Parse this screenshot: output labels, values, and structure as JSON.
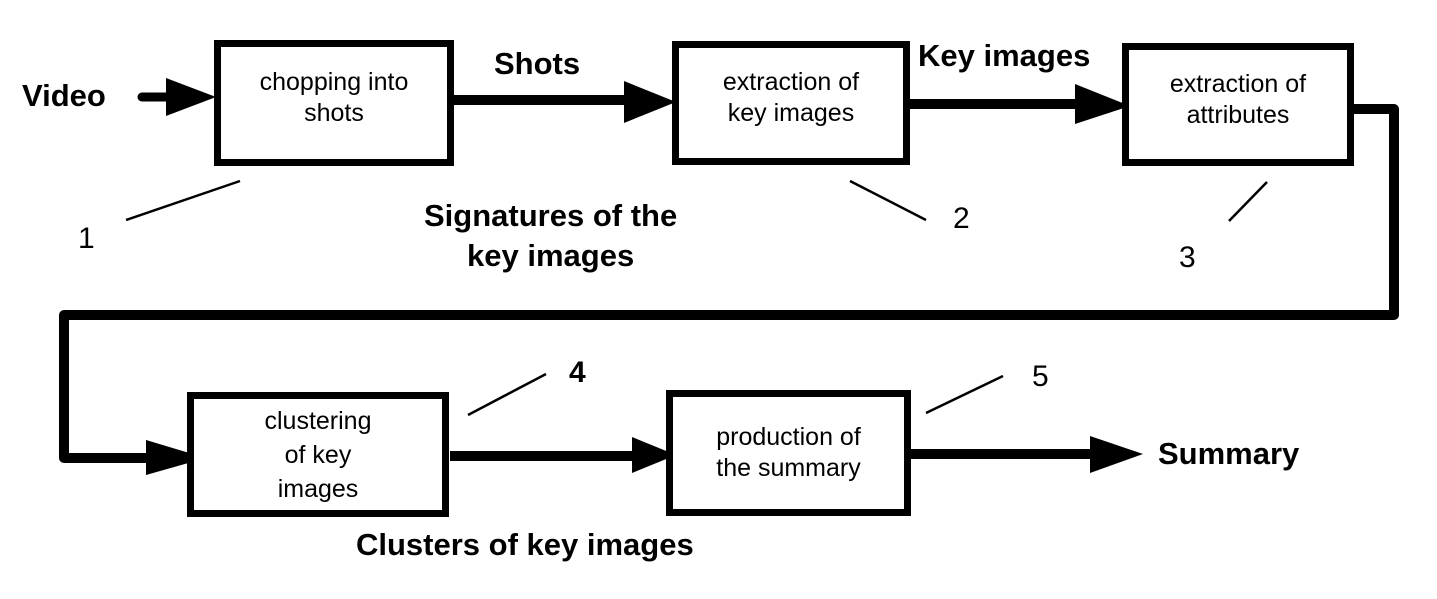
{
  "diagram": {
    "type": "flowchart",
    "steps": [
      {
        "id": "1",
        "label": "chopping into\nshots"
      },
      {
        "id": "2",
        "label": "extraction of\nkey images"
      },
      {
        "id": "3",
        "label": "extraction of\nattributes"
      },
      {
        "id": "4",
        "label": "clustering\nof key\nimages"
      },
      {
        "id": "5",
        "label": "production of\nthe summary"
      }
    ],
    "flow_labels": {
      "input": "Video",
      "shots": "Shots",
      "key_images": "Key images",
      "signatures": "Signatures of the\nkey images",
      "clusters": "Clusters of key images",
      "output": "Summary"
    },
    "edges": [
      {
        "from": "Video",
        "to": "1"
      },
      {
        "from": "1",
        "to": "2",
        "label": "Shots"
      },
      {
        "from": "2",
        "to": "3",
        "label": "Key images"
      },
      {
        "from": "3",
        "to": "4",
        "label": "Signatures of the key images"
      },
      {
        "from": "4",
        "to": "5",
        "label": "Clusters of key images"
      },
      {
        "from": "5",
        "to": "Summary"
      }
    ]
  }
}
